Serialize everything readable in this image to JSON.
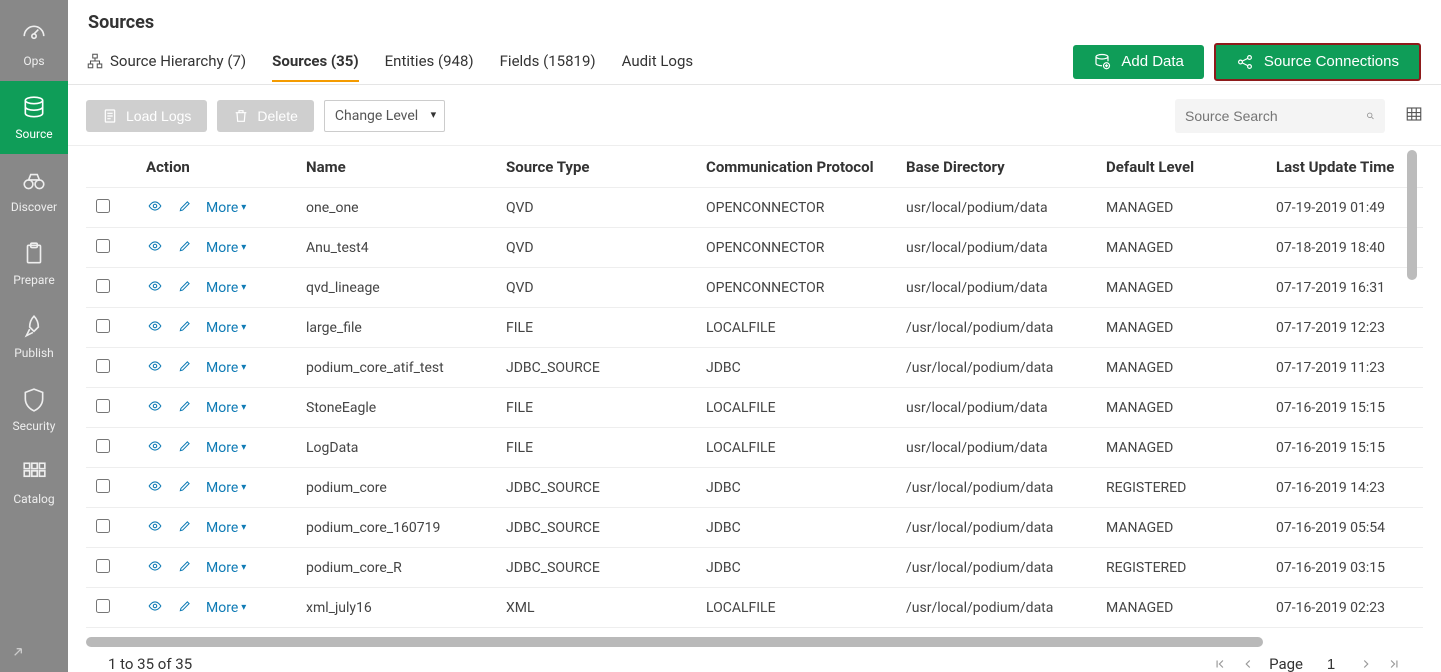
{
  "page": {
    "title": "Sources"
  },
  "sidebar": {
    "items": [
      {
        "label": "Ops"
      },
      {
        "label": "Source"
      },
      {
        "label": "Discover"
      },
      {
        "label": "Prepare"
      },
      {
        "label": "Publish"
      },
      {
        "label": "Security"
      },
      {
        "label": "Catalog"
      }
    ]
  },
  "tabs": [
    {
      "label": "Source Hierarchy (7)"
    },
    {
      "label": "Sources (35)"
    },
    {
      "label": "Entities (948)"
    },
    {
      "label": "Fields (15819)"
    },
    {
      "label": "Audit Logs"
    }
  ],
  "actions": {
    "add_data": "Add Data",
    "source_connections": "Source Connections"
  },
  "toolbar": {
    "load_logs": "Load Logs",
    "delete": "Delete",
    "change_level": "Change Level",
    "search_placeholder": "Source Search"
  },
  "columns": {
    "action": "Action",
    "name": "Name",
    "source_type": "Source Type",
    "comm_protocol": "Communication Protocol",
    "base_dir": "Base Directory",
    "default_level": "Default Level",
    "last_update": "Last Update Time"
  },
  "more_label": "More",
  "rows": [
    {
      "name": "one_one",
      "type": "QVD",
      "proto": "OPENCONNECTOR",
      "dir": "usr/local/podium/data",
      "level": "MANAGED",
      "updated": "07-19-2019 01:49"
    },
    {
      "name": "Anu_test4",
      "type": "QVD",
      "proto": "OPENCONNECTOR",
      "dir": "usr/local/podium/data",
      "level": "MANAGED",
      "updated": "07-18-2019 18:40"
    },
    {
      "name": "qvd_lineage",
      "type": "QVD",
      "proto": "OPENCONNECTOR",
      "dir": "usr/local/podium/data",
      "level": "MANAGED",
      "updated": "07-17-2019 16:31"
    },
    {
      "name": "large_file",
      "type": "FILE",
      "proto": "LOCALFILE",
      "dir": "/usr/local/podium/data",
      "level": "MANAGED",
      "updated": "07-17-2019 12:23"
    },
    {
      "name": "podium_core_atif_test",
      "type": "JDBC_SOURCE",
      "proto": "JDBC",
      "dir": "/usr/local/podium/data",
      "level": "MANAGED",
      "updated": "07-17-2019 11:23"
    },
    {
      "name": "StoneEagle",
      "type": "FILE",
      "proto": "LOCALFILE",
      "dir": "usr/local/podium/data",
      "level": "MANAGED",
      "updated": "07-16-2019 15:15"
    },
    {
      "name": "LogData",
      "type": "FILE",
      "proto": "LOCALFILE",
      "dir": "usr/local/podium/data",
      "level": "MANAGED",
      "updated": "07-16-2019 15:15"
    },
    {
      "name": "podium_core",
      "type": "JDBC_SOURCE",
      "proto": "JDBC",
      "dir": "/usr/local/podium/data",
      "level": "REGISTERED",
      "updated": "07-16-2019 14:23"
    },
    {
      "name": "podium_core_160719",
      "type": "JDBC_SOURCE",
      "proto": "JDBC",
      "dir": "/usr/local/podium/data",
      "level": "MANAGED",
      "updated": "07-16-2019 05:54"
    },
    {
      "name": "podium_core_R",
      "type": "JDBC_SOURCE",
      "proto": "JDBC",
      "dir": "/usr/local/podium/data",
      "level": "REGISTERED",
      "updated": "07-16-2019 03:15"
    },
    {
      "name": "xml_july16",
      "type": "XML",
      "proto": "LOCALFILE",
      "dir": "/usr/local/podium/data",
      "level": "MANAGED",
      "updated": "07-16-2019 02:23"
    }
  ],
  "footer": {
    "range": "1 to 35 of 35",
    "page_label": "Page",
    "page_number": "1"
  }
}
